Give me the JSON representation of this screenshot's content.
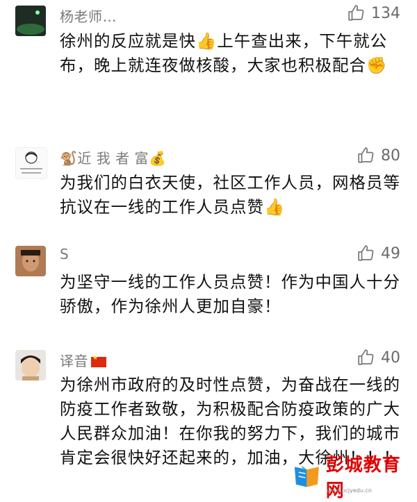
{
  "comments": [
    {
      "name": "杨老师…",
      "likes": "134",
      "text": "徐州的反应就是快👍上午查出来，下午就公布，晚上就连夜做核酸，大家也积极配合✊"
    },
    {
      "name": "🐒近 我 者 富💰",
      "likes": "80",
      "text": "为我们的白衣天使，社区工作人员，网格员等抗议在一线的工作人员点赞👍"
    },
    {
      "name": "S",
      "likes": "49",
      "text": "为坚守一线的工作人员点赞！作为中国人十分骄傲，作为徐州人更加自豪！"
    },
    {
      "name": "译音",
      "likes": "40",
      "text": "为徐州市政府的及时性点赞，为奋战在一线的防疫工作者致敬，为积极配合防疫政策的广大人民群众加油！在你我的努力下，我们的城市肯定会很快好还起来的，加油，大徐州！！！"
    }
  ],
  "watermark": {
    "title": "彭城教育网",
    "url": "www.pcjyedu.cn"
  }
}
